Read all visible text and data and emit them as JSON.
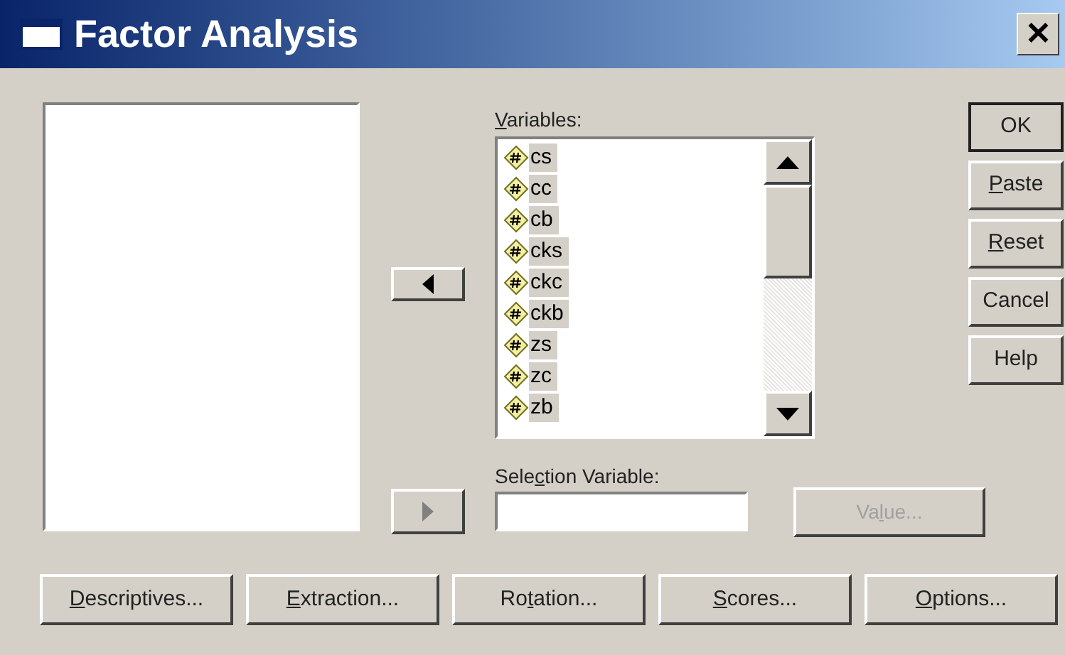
{
  "window": {
    "title": "Factor Analysis",
    "close": "✕"
  },
  "move_to_source": {
    "disabled": false
  },
  "variables": {
    "label": {
      "key": "V",
      "post": "ariables:"
    },
    "items": [
      {
        "name": "cs",
        "selected": true
      },
      {
        "name": "cc",
        "selected": true
      },
      {
        "name": "cb",
        "selected": true
      },
      {
        "name": "cks",
        "selected": true
      },
      {
        "name": "ckc",
        "selected": true
      },
      {
        "name": "ckb",
        "selected": true
      },
      {
        "name": "zs",
        "selected": true
      },
      {
        "name": "zc",
        "selected": true
      },
      {
        "name": "zb",
        "selected": true
      }
    ]
  },
  "selection_variable": {
    "label": {
      "pre": "Sele",
      "key": "c",
      "post": "tion Variable:"
    },
    "move_disabled": true,
    "value_button": {
      "label": {
        "pre": "Va",
        "key": "l",
        "post": "ue..."
      },
      "disabled": true
    }
  },
  "side_buttons": [
    {
      "label": {
        "post": "OK"
      },
      "default": true
    },
    {
      "label": {
        "key": "P",
        "post": "aste"
      },
      "default": false
    },
    {
      "label": {
        "key": "R",
        "post": "eset"
      },
      "default": false
    },
    {
      "label": {
        "post": "Cancel"
      },
      "default": false
    },
    {
      "label": {
        "post": "Help"
      },
      "default": false
    }
  ],
  "bottom_buttons": [
    {
      "label": {
        "key": "D",
        "post": "escriptives..."
      }
    },
    {
      "label": {
        "key": "E",
        "post": "xtraction..."
      }
    },
    {
      "label": {
        "pre": "Ro",
        "key": "t",
        "post": "ation..."
      }
    },
    {
      "label": {
        "key": "S",
        "post": "cores..."
      }
    },
    {
      "label": {
        "key": "O",
        "post": "ptions..."
      }
    }
  ]
}
